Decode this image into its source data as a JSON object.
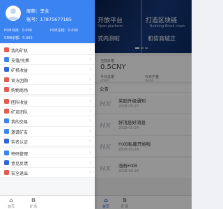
{
  "profile": {
    "nickname": "昵称：李永",
    "phone": "账号：17875677185",
    "hxb_balance": "HXB可用：0.000",
    "hxb_frozen": "HXB冻结：0.000",
    "rmb_balance": "RMB余额：0.000"
  },
  "drawer_menu": [
    {
      "label": "我的矿机",
      "color": "#e45b4f"
    },
    {
      "label": "充值/兑换",
      "color": "#3b83f0"
    },
    {
      "label": "矿机收益",
      "color": "#2f66d8"
    },
    {
      "label": "官方团购",
      "color": "#e45b4f"
    },
    {
      "label": "购物商场",
      "color": "#e45b4f"
    },
    {
      "label": "团队收益",
      "color": "#e45b4f"
    },
    {
      "label": "矿友团队",
      "color": "#e45b4f"
    },
    {
      "label": "我的交易",
      "color": "#3b83f0"
    },
    {
      "label": "邀请矿友",
      "color": "#3b83f0"
    },
    {
      "label": "实名认证",
      "color": "#2f66d8"
    },
    {
      "label": "密码管理",
      "color": "#3b83f0"
    },
    {
      "label": "意见反馈",
      "color": "#2f66d8"
    },
    {
      "label": "安全退出",
      "color": "#e45b4f"
    }
  ],
  "banner": {
    "left_title": "开放平台",
    "left_subtitle": "Open platform",
    "left_slogan": "式内测啦",
    "right_title": "打造区块链",
    "right_subtitle": "Building Block chain",
    "right_slogan": "和信商城正"
  },
  "stats": {
    "label1": "当前价格",
    "value1": "0.5CNY",
    "label2": "今日总量",
    "label3": "今日产量",
    "num2": "0000",
    "num3": "0000"
  },
  "notices_header": "公告",
  "notices": [
    {
      "title": "奖励升级通知",
      "date": "2018-05-27"
    },
    {
      "title": "好消息好消息",
      "date": "2018-05-24"
    },
    {
      "title": "HXB私募开始啦",
      "date": "2018-05-24"
    },
    {
      "title": "浅析HXB",
      "date": "2018-05-24"
    }
  ],
  "tabbar": {
    "home": "首页",
    "mine": "矿场"
  },
  "colors": {
    "accent": "#3b83f0",
    "active_tab": "#2f66d8"
  }
}
